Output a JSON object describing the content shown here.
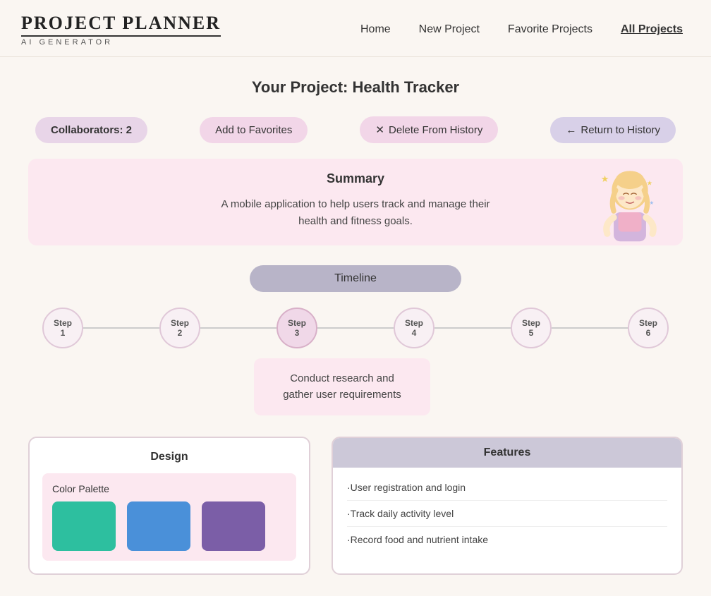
{
  "logo": {
    "title": "PROJECT PLANNER",
    "subtitle": "AI GENERATOR"
  },
  "nav": {
    "links": [
      {
        "label": "Home",
        "active": false
      },
      {
        "label": "New Project",
        "active": false
      },
      {
        "label": "Favorite Projects",
        "active": false
      },
      {
        "label": "All Projects",
        "active": true
      }
    ]
  },
  "page": {
    "title_prefix": "Your Project: ",
    "title_bold": "Health Tracker"
  },
  "actions": {
    "collaborators": "Collaborators: 2",
    "add_favorites": "Add to Favorites",
    "delete_history": "Delete From History",
    "return_history": "Return to History",
    "x_icon": "✕",
    "arrow_icon": "←"
  },
  "summary": {
    "title": "Summary",
    "text": "A mobile application to help users track and manage their health and fitness goals."
  },
  "timeline": {
    "label": "Timeline",
    "steps": [
      {
        "label": "Step",
        "number": "1"
      },
      {
        "label": "Step",
        "number": "2"
      },
      {
        "label": "Step",
        "number": "3"
      },
      {
        "label": "Step",
        "number": "4"
      },
      {
        "label": "Step",
        "number": "5"
      },
      {
        "label": "Step",
        "number": "6"
      }
    ],
    "active_step": 3,
    "step_detail": "Conduct research and gather user requirements"
  },
  "design": {
    "title": "Design",
    "color_palette_label": "Color Palette",
    "colors": [
      {
        "hex": "#2dbf9f",
        "name": "teal"
      },
      {
        "hex": "#4a90d9",
        "name": "blue"
      },
      {
        "hex": "#7b5ea7",
        "name": "purple"
      }
    ]
  },
  "features": {
    "title": "Features",
    "items": [
      "·User registration and login",
      "·Track daily activity level",
      "·Record food and nutrient intake"
    ]
  }
}
